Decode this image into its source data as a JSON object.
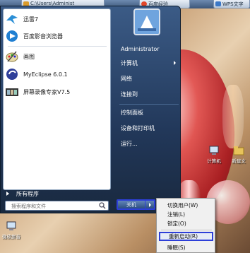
{
  "taskbar": {
    "tabs": [
      {
        "label": "C:\\Users\\Administ"
      },
      {
        "label": "百度经验_"
      },
      {
        "label": "WPS文字"
      }
    ]
  },
  "start_menu": {
    "pinned": [
      {
        "label": "迅雷7",
        "icon": "xunlei-bird-icon"
      },
      {
        "label": "百度影音浏览器",
        "icon": "baidu-player-icon"
      }
    ],
    "recent": [
      {
        "label": "画图",
        "icon": "paint-palette-icon"
      },
      {
        "label": "MyEclipse 6.0.1",
        "icon": "myeclipse-icon"
      },
      {
        "label": "屏幕录像专家V7.5",
        "icon": "film-strip-icon"
      }
    ],
    "all_programs": "所有程序",
    "search_placeholder": "搜索程序和文件",
    "user": "Administrator",
    "right_items": [
      {
        "label": "计算机",
        "has_arrow": true
      },
      {
        "label": "网络",
        "has_arrow": false
      },
      {
        "label": "连接到",
        "has_arrow": false
      },
      {
        "label": "控制面板",
        "has_arrow": false
      },
      {
        "label": "设备和打印机",
        "has_arrow": false
      },
      {
        "label": "运行...",
        "has_arrow": false
      }
    ],
    "shutdown_label": "关机"
  },
  "power_submenu": {
    "items": [
      {
        "label": "切换用户(W)",
        "highlighted": false
      },
      {
        "label": "注销(L)",
        "highlighted": false
      },
      {
        "label": "锁定(O)",
        "highlighted": false
      },
      {
        "label": "重新启动(R)",
        "highlighted": true
      },
      {
        "label": "睡眠(S)",
        "highlighted": false
      }
    ]
  },
  "desktop_icons": [
    {
      "label": "计算机",
      "icon": "computer-icon"
    },
    {
      "label": "新建文",
      "icon": "folder-icon"
    },
    {
      "label": "微软拼音",
      "icon": "computer-icon"
    }
  ],
  "colors": {
    "highlight_border": "#2d3fd8",
    "menu_bg": "#22385a"
  }
}
